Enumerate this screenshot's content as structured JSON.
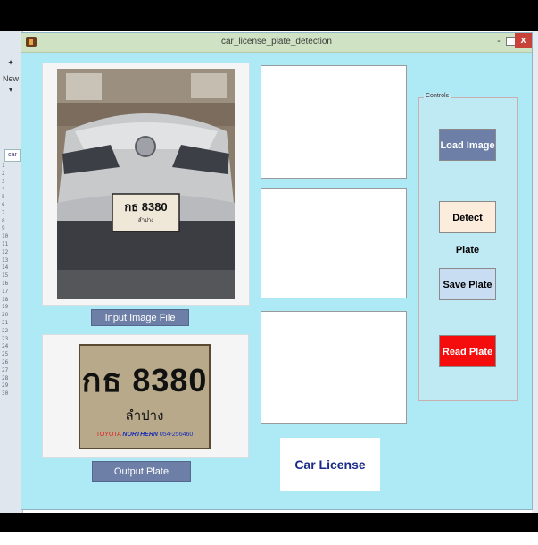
{
  "editor": {
    "new_label": "New",
    "tab_label": "car",
    "line_numbers": [
      "1",
      "2",
      "3",
      "4",
      "5",
      "6",
      "7",
      "8",
      "9",
      "10",
      "11",
      "12",
      "13",
      "14",
      "15",
      "16",
      "17",
      "18",
      "19",
      "20",
      "21",
      "22",
      "23",
      "24",
      "25",
      "26",
      "27",
      "28",
      "29",
      "30"
    ]
  },
  "window": {
    "title": "car_license_plate_detection",
    "minimize": "-",
    "close": "x"
  },
  "input_image": {
    "caption": "Input Image File",
    "plate_text": "กธ 8380",
    "plate_sub": "ลำปาง"
  },
  "output_plate": {
    "caption": "Output Plate",
    "plate_text": "กธ 8380",
    "plate_province": "ลำปาง",
    "dealer_brand": "TOYOTA",
    "dealer_name": "NORTHERN",
    "dealer_phone": "054-256460"
  },
  "brand_title": "Car License Plate",
  "controls": {
    "legend": "Controls",
    "buttons": [
      {
        "label": "Load Image",
        "bg": "#6e7fa7",
        "fg": "#ffffff"
      },
      {
        "label": "Detect Plate",
        "bg": "#fbecdc",
        "fg": "#000000"
      },
      {
        "label": "Save Plate",
        "bg": "#c9ddf2",
        "fg": "#000000"
      },
      {
        "label": "Read Plate",
        "bg": "#f50d0d",
        "fg": "#ffffff"
      }
    ]
  },
  "colors": {
    "window_bg": "#aee9f6",
    "caption_bg": "#6e7fa7",
    "brand_text": "#1b2a86"
  }
}
